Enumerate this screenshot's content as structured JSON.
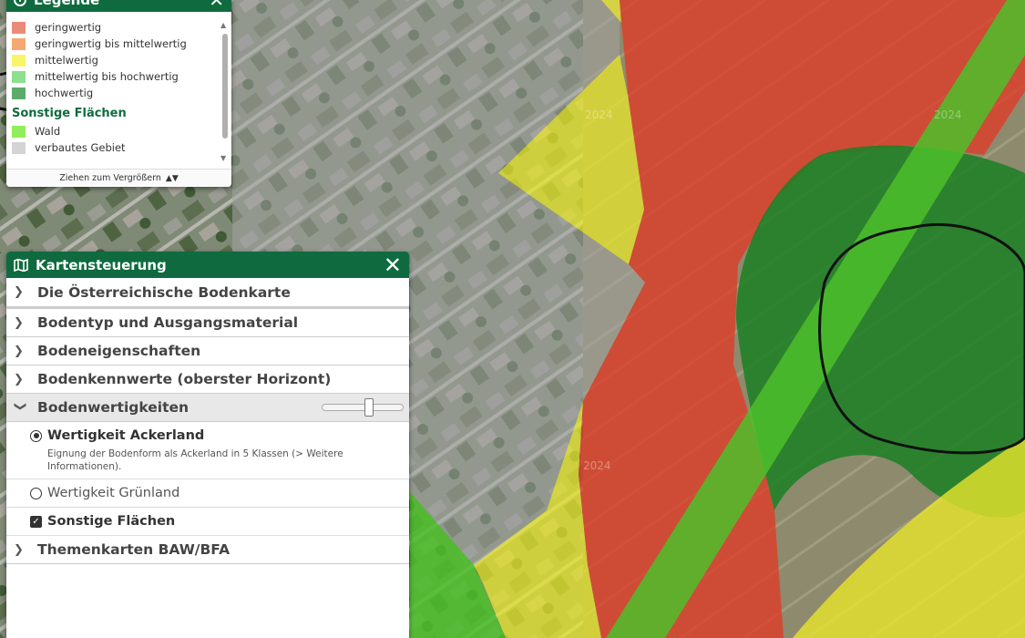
{
  "legend": {
    "title": "Legende",
    "items": [
      {
        "label": "geringwertig",
        "color": "#ea8a78"
      },
      {
        "label": "geringwertig bis mittelwertig",
        "color": "#f5a870"
      },
      {
        "label": "mittelwertig",
        "color": "#f8f56a"
      },
      {
        "label": "mittelwertig bis hochwertig",
        "color": "#8de08d"
      },
      {
        "label": "hochwertig",
        "color": "#5cab6a"
      }
    ],
    "section_title": "Sonstige Flächen",
    "other_items": [
      {
        "label": "Wald",
        "color": "#90ee5a"
      },
      {
        "label": "verbautes Gebiet",
        "color": "#d4d4d4"
      }
    ],
    "resize_label": "Ziehen zum Vergrößern"
  },
  "control": {
    "title": "Kartensteuerung",
    "sections": [
      {
        "label": "Die Österreichische Bodenkarte"
      },
      {
        "label": "Bodentyp und Ausgangsmaterial"
      },
      {
        "label": "Bodeneigenschaften"
      },
      {
        "label": "Bodenkennwerte (oberster Horizont)"
      },
      {
        "label": "Bodenwertigkeiten"
      },
      {
        "label": "Themenkarten BAW/BFA"
      }
    ],
    "opacity_slider_value": 0.58,
    "options": [
      {
        "label": "Wertigkeit Ackerland",
        "description": "Eignung der Bodenform als Ackerland in 5 Klassen (> Weitere Informationen).",
        "selected": true
      },
      {
        "label": "Wertigkeit Grünland",
        "selected": false
      },
      {
        "label": "Sonstige Flächen",
        "checked": true
      }
    ]
  },
  "map": {
    "watermarks": [
      "2024",
      "2024",
      "2024"
    ],
    "colors": {
      "red": "#e03b25",
      "yellow": "#e8e52c",
      "green_strip": "#4cc02a",
      "dark_green": "#1f7f25",
      "built": "#9fa09f"
    }
  }
}
